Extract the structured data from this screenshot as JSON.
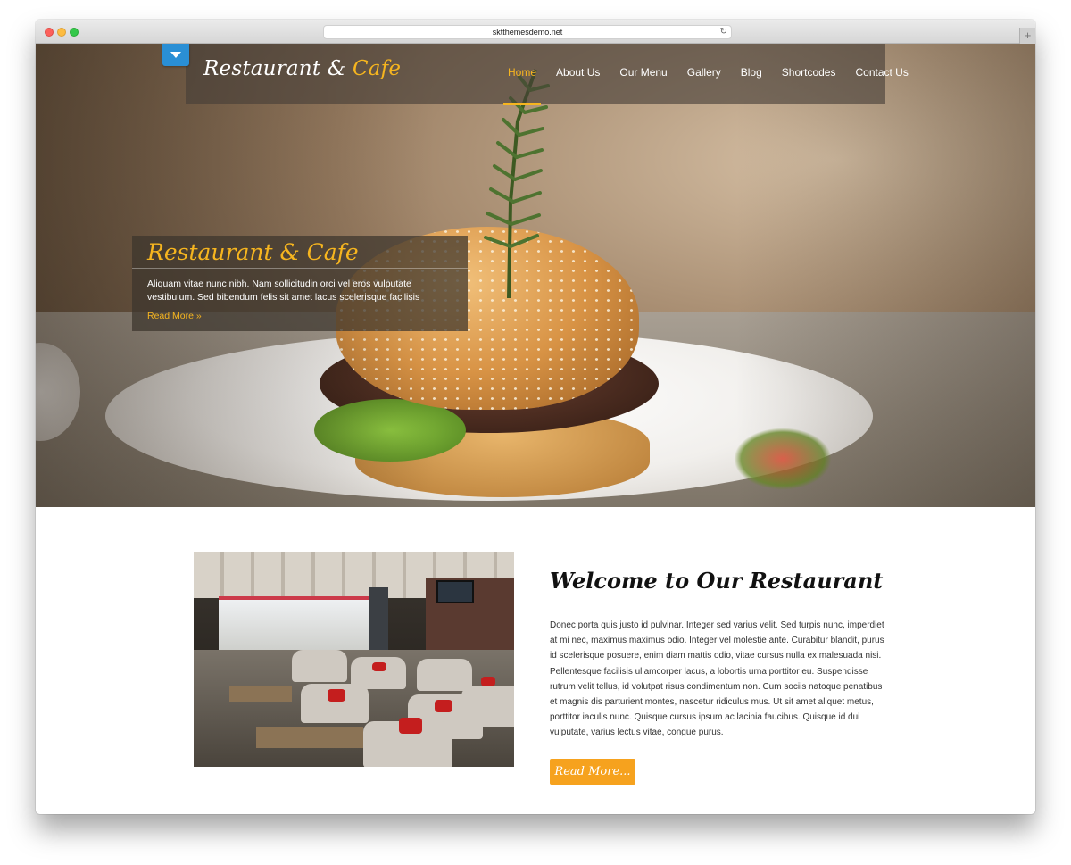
{
  "browser": {
    "url": "sktthemesdemo.net",
    "new_tab_label": "+"
  },
  "header": {
    "logo_part1": "Restaurant &",
    "logo_part2": "Cafe",
    "nav": [
      {
        "label": "Home",
        "active": true
      },
      {
        "label": "About Us",
        "active": false
      },
      {
        "label": "Our Menu",
        "active": false
      },
      {
        "label": "Gallery",
        "active": false
      },
      {
        "label": "Blog",
        "active": false
      },
      {
        "label": "Shortcodes",
        "active": false
      },
      {
        "label": "Contact Us",
        "active": false
      }
    ]
  },
  "hero": {
    "title": "Restaurant & Cafe",
    "text": "Aliquam vitae nunc nibh. Nam sollicitudin orci vel eros vulputate vestibulum. Sed bibendum felis sit amet lacus scelerisque facilisis",
    "link_label": "Read More »"
  },
  "welcome": {
    "title": "Welcome to Our Restaurant",
    "text": "Donec porta quis justo id pulvinar. Integer sed varius velit. Sed turpis nunc, imperdiet at mi nec, maximus maximus odio. Integer vel molestie ante. Curabitur blandit, purus id scelerisque posuere, enim diam mattis odio, vitae cursus nulla ex malesuada nisi. Pellentesque facilisis ullamcorper lacus, a lobortis urna porttitor eu. Suspendisse rutrum velit tellus, id volutpat risus condimentum non. Cum sociis natoque penatibus et magnis dis parturient montes, nascetur ridiculus mus. Ut sit amet aliquet metus, porttitor iaculis nunc. Quisque cursus ipsum ac lacinia faucibus. Quisque id dui vulputate, varius lectus vitae, congue purus.",
    "button_label": "Read More..."
  },
  "colors": {
    "accent": "#f6b51f",
    "button": "#f6a21e",
    "toggle": "#2a8fd5"
  },
  "icons": {
    "menu_toggle": "chevron-down-icon",
    "reload": "reload-icon"
  }
}
